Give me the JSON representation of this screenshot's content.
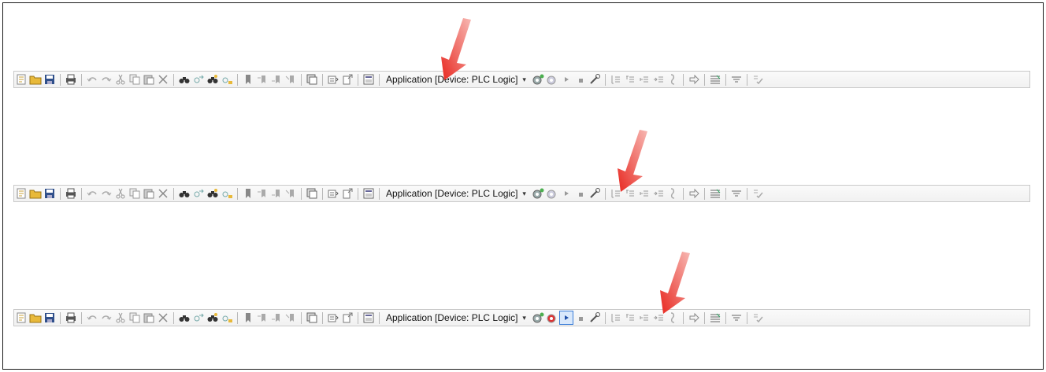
{
  "application_selector": "Application [Device: PLC Logic]",
  "dropdown_glyph": "▾",
  "toolbars": [
    {
      "name": "toolbar-before-login",
      "active_button": "none"
    },
    {
      "name": "toolbar-after-login",
      "active_button": "none"
    },
    {
      "name": "toolbar-running",
      "active_button": "start-icon"
    }
  ],
  "icons": [
    "new-file-icon",
    "open-folder-icon",
    "save-icon",
    "print-icon",
    "undo-icon",
    "redo-icon",
    "cut-icon",
    "copy-icon",
    "paste-icon",
    "delete-icon",
    "find-icon",
    "find-next-icon",
    "replace-icon",
    "replace-next-icon",
    "bookmark-icon",
    "bookmark-next-icon",
    "bookmark-prev-icon",
    "bookmark-clear-icon",
    "grid-icon",
    "build-icon",
    "export-icon",
    "visualization-icon",
    "login-icon",
    "logout-icon",
    "start-icon",
    "stop-icon",
    "reset-icon",
    "step-over-icon",
    "step-into-icon",
    "step-out-icon",
    "set-next-icon",
    "breakpoint-icon",
    "go-icon",
    "display-icon",
    "filter-icon",
    "validate-icon"
  ],
  "colors": {
    "arrow": "#e8271f",
    "highlight": "#3b7ed8"
  }
}
